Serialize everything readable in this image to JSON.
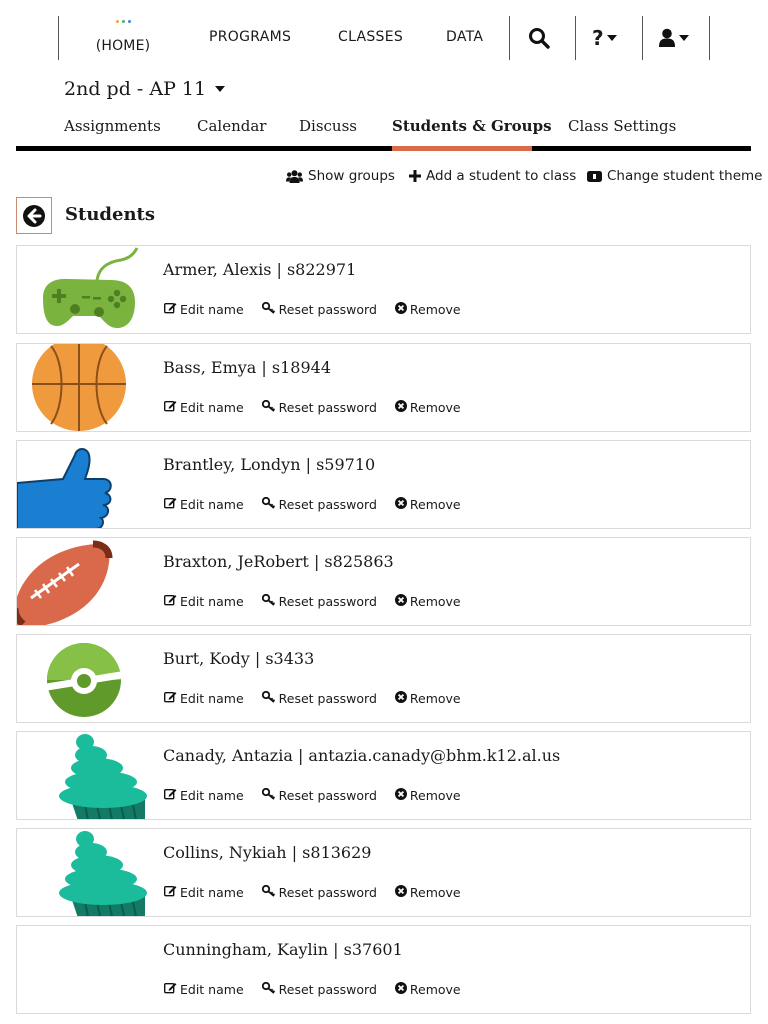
{
  "nav": {
    "home_label": "(HOME)",
    "home_dot_colors": [
      "#f2a531",
      "#3cb87a",
      "#3e86d6"
    ],
    "links": [
      {
        "label": "PROGRAMS"
      },
      {
        "label": "CLASSES"
      },
      {
        "label": "DATA"
      }
    ],
    "icons": {
      "search": "search-icon",
      "help": "help-icon",
      "user": "user-icon"
    }
  },
  "class_selector": {
    "label": "2nd pd - AP 11"
  },
  "tabs": [
    {
      "label": "Assignments",
      "active": false
    },
    {
      "label": "Calendar",
      "active": false
    },
    {
      "label": "Discuss",
      "active": false
    },
    {
      "label": "Students & Groups",
      "active": true
    },
    {
      "label": "Class Settings",
      "active": false
    }
  ],
  "toolbar": {
    "show_groups": "Show groups",
    "add_student": "Add a student to class",
    "change_theme": "Change student theme"
  },
  "section": {
    "title": "Students"
  },
  "student_actions": {
    "edit": "Edit name",
    "reset": "Reset password",
    "remove": "Remove"
  },
  "students": [
    {
      "name": "Armer, Alexis | s822971",
      "avatar": "gamepad"
    },
    {
      "name": "Bass, Emya | s18944",
      "avatar": "basketball"
    },
    {
      "name": "Brantley, Londyn | s59710",
      "avatar": "thumbs-up"
    },
    {
      "name": "Braxton, JeRobert | s825863",
      "avatar": "football"
    },
    {
      "name": "Burt, Kody | s3433",
      "avatar": "pokeball"
    },
    {
      "name": "Canady, Antazia | antazia.canady@bhm.k12.al.us",
      "avatar": "cupcake"
    },
    {
      "name": "Collins, Nykiah | s813629",
      "avatar": "cupcake"
    },
    {
      "name": "Cunningham, Kaylin | s37601",
      "avatar": "none"
    }
  ],
  "colors": {
    "accent": "#d96b4a",
    "gamepad": "#7ab33e",
    "basketball": "#ef9a3c",
    "thumbs_up": "#1b7fd1",
    "football": "#d9694a",
    "pokeball": "#5f9a2a",
    "cupcake": "#1abc9c"
  }
}
